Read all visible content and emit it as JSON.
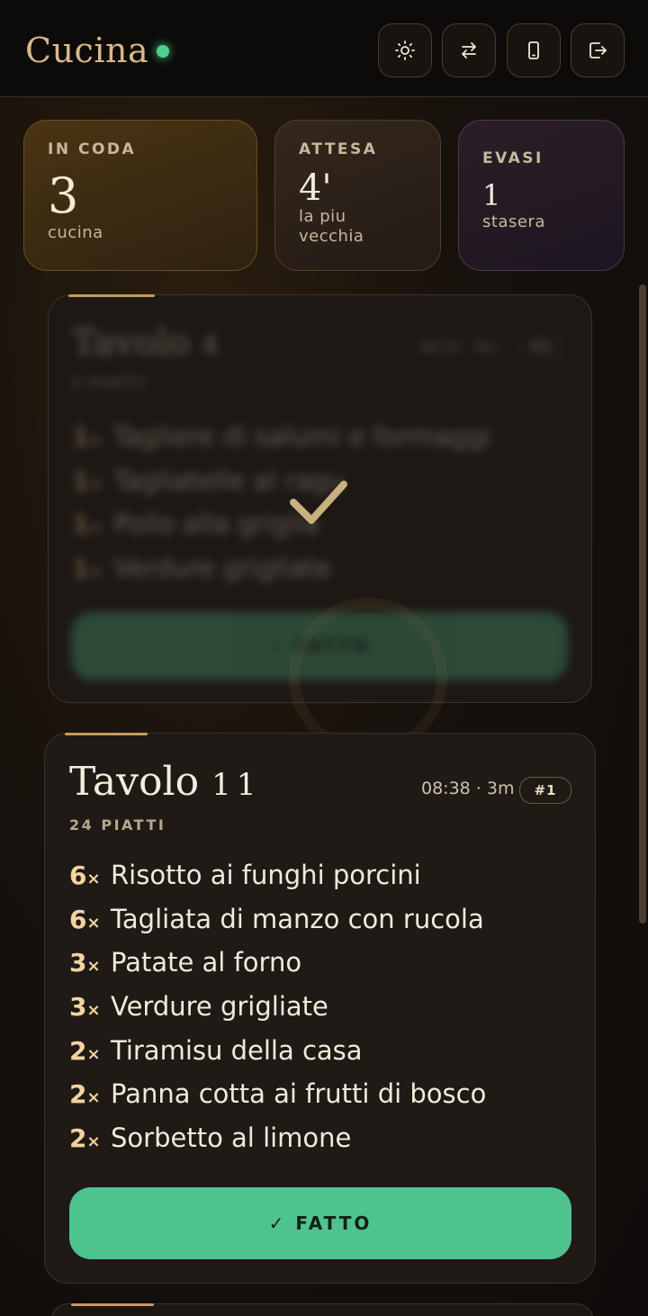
{
  "header": {
    "title": "Cucina",
    "status": "online",
    "buttons": [
      {
        "icon": "sun-icon",
        "name": "theme-toggle-button"
      },
      {
        "icon": "swap-icon",
        "name": "switch-view-button"
      },
      {
        "icon": "phone-icon",
        "name": "mobile-view-button"
      },
      {
        "icon": "logout-icon",
        "name": "logout-button"
      }
    ]
  },
  "stats": {
    "in_coda": {
      "label": "IN CODA",
      "value": "3",
      "sub": "cucina"
    },
    "attesa": {
      "label": "ATTESA",
      "value": "4'",
      "sub1": "la piu",
      "sub2": "vecchia"
    },
    "evasi": {
      "label": "EVASI",
      "value": "1",
      "sub": "stasera"
    }
  },
  "orders": [
    {
      "title": "Tavolo",
      "number": "4",
      "time": "08:31 · 6m",
      "badge": "#1",
      "piatti": "4 PIATTI",
      "state": "completing",
      "items": [
        {
          "qty": "1",
          "mult": "×",
          "dish": "Tagliere di salumi e formaggi"
        },
        {
          "qty": "1",
          "mult": "×",
          "dish": "Tagliatelle al ragu"
        },
        {
          "qty": "1",
          "mult": "×",
          "dish": "Pollo alla griglia"
        },
        {
          "qty": "1",
          "mult": "×",
          "dish": "Verdure grigliate"
        }
      ],
      "done_label": "✓ FATTO"
    },
    {
      "title": "Tavolo",
      "number": "11",
      "time": "08:38 · 3m",
      "badge": "#1",
      "piatti": "24 PIATTI",
      "items": [
        {
          "qty": "6",
          "mult": "×",
          "dish": "Risotto ai funghi porcini"
        },
        {
          "qty": "6",
          "mult": "×",
          "dish": "Tagliata di manzo con rucola"
        },
        {
          "qty": "3",
          "mult": "×",
          "dish": "Patate al forno"
        },
        {
          "qty": "3",
          "mult": "×",
          "dish": "Verdure grigliate"
        },
        {
          "qty": "2",
          "mult": "×",
          "dish": "Tiramisu della casa"
        },
        {
          "qty": "2",
          "mult": "×",
          "dish": "Panna cotta ai frutti di bosco"
        },
        {
          "qty": "2",
          "mult": "×",
          "dish": "Sorbetto al limone"
        }
      ],
      "done_label": "✓ FATTO"
    }
  ],
  "colors": {
    "accent": "#c59a5e",
    "success": "#4fc38d",
    "status_dot": "#4fd08e"
  }
}
